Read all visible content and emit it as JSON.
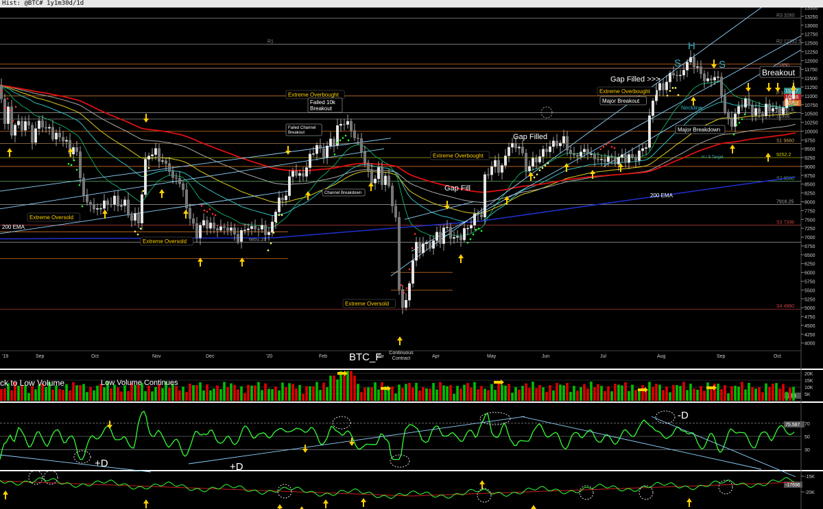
{
  "window": {
    "title": "Hist: @BTC# 1y1m30d/1d"
  },
  "colors": {
    "bg": "#000000",
    "up": "#00c000",
    "down": "#e00000",
    "wick": "#cfcfcf",
    "arrow": "#ffd000",
    "note_box": "#ffd000",
    "trend": "#8fd3ff",
    "ema200": "#e01010",
    "ema100": "#e0d020",
    "ema50": "#30c0c0",
    "sma_blue": "#2030d0",
    "rsi": "#33ff33",
    "obv": "#33ff33",
    "obv_ma": "#cc2020"
  },
  "chart_data": [
    {
      "type": "candlestick",
      "symbol_label": "BTC_F",
      "symbol_note": "Continuous\nContract",
      "x_labels": [
        "'19",
        "Sep",
        "Oct",
        "Nov",
        "Dec",
        "'20",
        "Feb",
        "Mar",
        "Apr",
        "May",
        "Jun",
        "Jul",
        "Aug",
        "Sep",
        "Oct"
      ],
      "y_ticks": [
        4000,
        4250,
        4500,
        4750,
        5000,
        5250,
        5500,
        5750,
        6000,
        6250,
        6500,
        6750,
        7000,
        7250,
        7500,
        7750,
        8000,
        8250,
        8500,
        8750,
        9000,
        9250,
        9500,
        9750,
        10000,
        10250,
        10500,
        10750,
        11000,
        11250,
        11500,
        11750,
        12000,
        12250,
        12500,
        12750,
        13000,
        13250,
        13500
      ],
      "ylim": [
        3800,
        13500
      ],
      "close_path": [
        [
          0,
          11300
        ],
        [
          6,
          10200
        ],
        [
          12,
          10600
        ],
        [
          18,
          9800
        ],
        [
          24,
          10400
        ],
        [
          30,
          10000
        ],
        [
          36,
          10300
        ],
        [
          42,
          10100
        ],
        [
          48,
          9700
        ],
        [
          54,
          10200
        ],
        [
          60,
          10300
        ],
        [
          66,
          10000
        ],
        [
          72,
          10100
        ],
        [
          78,
          9800
        ],
        [
          84,
          9900
        ],
        [
          90,
          9800
        ],
        [
          96,
          9700
        ],
        [
          102,
          9400
        ],
        [
          108,
          9600
        ],
        [
          114,
          9200
        ],
        [
          120,
          8300
        ],
        [
          126,
          7900
        ],
        [
          132,
          8000
        ],
        [
          138,
          7700
        ],
        [
          144,
          7800
        ],
        [
          150,
          8000
        ],
        [
          156,
          7900
        ],
        [
          162,
          8000
        ],
        [
          168,
          8100
        ],
        [
          174,
          7800
        ],
        [
          180,
          8100
        ],
        [
          186,
          7700
        ],
        [
          192,
          7500
        ],
        [
          198,
          7600
        ],
        [
          204,
          7400
        ],
        [
          210,
          9000
        ],
        [
          216,
          9400
        ],
        [
          222,
          9300
        ],
        [
          228,
          9500
        ],
        [
          234,
          9100
        ],
        [
          240,
          9100
        ],
        [
          246,
          9000
        ],
        [
          252,
          8600
        ],
        [
          258,
          8700
        ],
        [
          264,
          8500
        ],
        [
          270,
          8000
        ],
        [
          276,
          7600
        ],
        [
          282,
          7300
        ],
        [
          288,
          7000
        ],
        [
          294,
          7500
        ],
        [
          300,
          7300
        ],
        [
          306,
          7400
        ],
        [
          312,
          7200
        ],
        [
          318,
          7300
        ],
        [
          324,
          7200
        ],
        [
          330,
          7300
        ],
        [
          336,
          7200
        ],
        [
          342,
          7100
        ],
        [
          348,
          6900
        ],
        [
          354,
          7200
        ],
        [
          360,
          7300
        ],
        [
          366,
          7200
        ],
        [
          372,
          7300
        ],
        [
          378,
          7200
        ],
        [
          384,
          7300
        ],
        [
          390,
          7000
        ],
        [
          396,
          7300
        ],
        [
          402,
          7800
        ],
        [
          408,
          8100
        ],
        [
          414,
          8000
        ],
        [
          420,
          8500
        ],
        [
          426,
          8900
        ],
        [
          432,
          8800
        ],
        [
          438,
          8700
        ],
        [
          444,
          8800
        ],
        [
          450,
          9200
        ],
        [
          456,
          9400
        ],
        [
          462,
          9600
        ],
        [
          468,
          9400
        ],
        [
          474,
          9300
        ],
        [
          480,
          9800
        ],
        [
          486,
          9600
        ],
        [
          492,
          10100
        ],
        [
          498,
          10200
        ],
        [
          504,
          10300
        ],
        [
          510,
          10100
        ],
        [
          516,
          9900
        ],
        [
          522,
          9700
        ],
        [
          528,
          9400
        ],
        [
          534,
          9000
        ],
        [
          540,
          8600
        ],
        [
          546,
          8600
        ],
        [
          552,
          8900
        ],
        [
          558,
          8500
        ],
        [
          564,
          8800
        ],
        [
          570,
          8000
        ],
        [
          576,
          7900
        ],
        [
          582,
          5500
        ],
        [
          588,
          5000
        ],
        [
          594,
          5200
        ],
        [
          600,
          6200
        ],
        [
          606,
          6800
        ],
        [
          612,
          6600
        ],
        [
          618,
          6900
        ],
        [
          624,
          6700
        ],
        [
          630,
          6800
        ],
        [
          636,
          7100
        ],
        [
          642,
          6900
        ],
        [
          648,
          7300
        ],
        [
          654,
          7200
        ],
        [
          660,
          6900
        ],
        [
          666,
          7000
        ],
        [
          672,
          7000
        ],
        [
          678,
          7200
        ],
        [
          684,
          7300
        ],
        [
          690,
          7500
        ],
        [
          696,
          7700
        ],
        [
          702,
          7600
        ],
        [
          708,
          8900
        ],
        [
          714,
          8800
        ],
        [
          720,
          9200
        ],
        [
          726,
          8900
        ],
        [
          732,
          9000
        ],
        [
          738,
          9300
        ],
        [
          744,
          9800
        ],
        [
          750,
          9400
        ],
        [
          756,
          9700
        ],
        [
          762,
          9300
        ],
        [
          768,
          8800
        ],
        [
          774,
          9200
        ],
        [
          780,
          9100
        ],
        [
          786,
          9300
        ],
        [
          792,
          9400
        ],
        [
          798,
          9500
        ],
        [
          804,
          9600
        ],
        [
          810,
          9700
        ],
        [
          816,
          9600
        ],
        [
          822,
          9800
        ],
        [
          828,
          9500
        ],
        [
          834,
          9200
        ],
        [
          840,
          9400
        ],
        [
          846,
          9300
        ],
        [
          852,
          9500
        ],
        [
          858,
          9400
        ],
        [
          864,
          9200
        ],
        [
          870,
          9300
        ],
        [
          876,
          9100
        ],
        [
          882,
          9200
        ],
        [
          888,
          9300
        ],
        [
          894,
          9100
        ],
        [
          900,
          9200
        ],
        [
          906,
          9300
        ],
        [
          912,
          9200
        ],
        [
          918,
          9300
        ],
        [
          924,
          9200
        ],
        [
          930,
          9300
        ],
        [
          936,
          9500
        ],
        [
          942,
          9600
        ],
        [
          948,
          10500
        ],
        [
          954,
          11100
        ],
        [
          960,
          11300
        ],
        [
          966,
          11200
        ],
        [
          972,
          11400
        ],
        [
          978,
          11600
        ],
        [
          984,
          11700
        ],
        [
          990,
          11400
        ],
        [
          996,
          11800
        ],
        [
          1002,
          11900
        ],
        [
          1008,
          12100
        ],
        [
          1014,
          11800
        ],
        [
          1020,
          11700
        ],
        [
          1026,
          11500
        ],
        [
          1032,
          11400
        ],
        [
          1038,
          11500
        ],
        [
          1044,
          11600
        ],
        [
          1050,
          11300
        ],
        [
          1056,
          10600
        ],
        [
          1062,
          10300
        ],
        [
          1068,
          10200
        ],
        [
          1074,
          10600
        ],
        [
          1080,
          10700
        ],
        [
          1086,
          10900
        ],
        [
          1092,
          10700
        ],
        [
          1098,
          10500
        ],
        [
          1104,
          10600
        ],
        [
          1110,
          10400
        ],
        [
          1116,
          10700
        ],
        [
          1122,
          10600
        ],
        [
          1128,
          10700
        ],
        [
          1134,
          10500
        ],
        [
          1140,
          10600
        ],
        [
          1146,
          10800
        ],
        [
          1152,
          11000
        ],
        [
          1158,
          11300
        ]
      ],
      "horizontal_levels": [
        {
          "label": "R3 3280",
          "value": 13200
        },
        {
          "label": "R2 12332.5",
          "value": 12460
        },
        {
          "label": "R1",
          "value": 12460
        },
        {
          "label": "11850",
          "value": 11780
        },
        {
          "label": "P 10990",
          "value": 11000
        },
        {
          "label": "10582.5",
          "value": 10520
        },
        {
          "label": "10396",
          "value": 10340
        },
        {
          "label": "S1 9660",
          "value": 9650
        },
        {
          "label": "9252.2",
          "value": 9250
        },
        {
          "label": "S2 8580",
          "value": 8580
        },
        {
          "label": "7916.25",
          "value": 7920
        },
        {
          "label": "S3 7336",
          "value": 7336
        },
        {
          "label": "6851.25",
          "value": 6851
        },
        {
          "label": "S4 4960",
          "value": 4960
        }
      ],
      "right_value_tags": [
        "11017",
        "10955",
        "10702"
      ],
      "annotations": [
        "Extreme Oversold",
        "Extreme Oversold",
        "Extreme Oversold",
        "200 EMA",
        "200 EMA",
        "Extreme Overbought",
        "Failed 10k\nBreakout",
        "Failed Channel\nBreakout",
        "Channel Breakdown",
        "Gap Fill",
        "Gap Filled",
        "Extreme Overbought",
        "Extreme Overbought",
        "Major Breakout",
        "Gap Filled >>>",
        "Neckline",
        "Major Breakdown",
        "H / S Target",
        "Breakout",
        "S",
        "H",
        "S"
      ]
    },
    {
      "type": "bar",
      "name": "volume",
      "titles": [
        "ck to Low Volume",
        "Low Volume Continues"
      ],
      "y_ticks": [
        "20K",
        "15K",
        "10K",
        "5K"
      ],
      "last_value": "6213"
    },
    {
      "type": "line",
      "name": "oscillator",
      "y_ticks": [
        "70",
        "50",
        "30"
      ],
      "last_value": "75.587",
      "labels": [
        "+D",
        "+D",
        "-D"
      ]
    },
    {
      "type": "line",
      "name": "obv",
      "y_ticks": [
        "-15K",
        "-20K"
      ],
      "last_value": "-17696"
    }
  ]
}
